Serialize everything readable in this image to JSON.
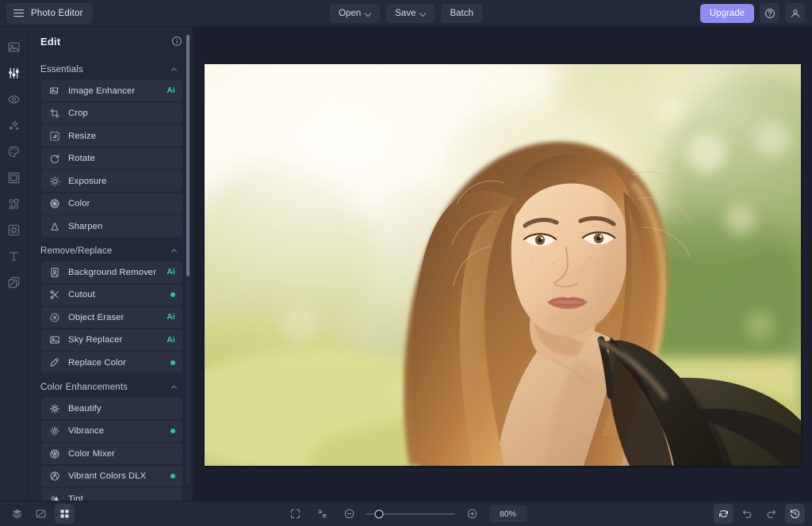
{
  "app": {
    "name": "Photo Editor",
    "menu_icon": "hamburger-icon"
  },
  "topbar": {
    "open_label": "Open",
    "save_label": "Save",
    "batch_label": "Batch",
    "upgrade_label": "Upgrade",
    "help_icon": "question-circle-icon",
    "account_icon": "user-icon",
    "accent_color": "#8f8cf5"
  },
  "rail": {
    "items": [
      {
        "icon": "image-icon",
        "active": false
      },
      {
        "icon": "sliders-icon",
        "active": true
      },
      {
        "icon": "eye-icon",
        "active": false
      },
      {
        "icon": "sparkles-icon",
        "active": false
      },
      {
        "icon": "palette-icon",
        "active": false
      },
      {
        "icon": "frame-icon",
        "active": false
      },
      {
        "icon": "shapes-icon",
        "active": false
      },
      {
        "icon": "effects-icon",
        "active": false
      },
      {
        "icon": "text-icon",
        "active": false
      },
      {
        "icon": "layers-copy-icon",
        "active": false
      }
    ]
  },
  "panel": {
    "title": "Edit",
    "info_icon": "info-circle-icon",
    "ai_badge_color": "#2fd6a8",
    "dot_badge_color": "#21cf9a",
    "sections": [
      {
        "name": "Essentials",
        "expanded": true,
        "items": [
          {
            "label": "Image Enhancer",
            "icon": "image-enhance-icon",
            "badge": "Ai"
          },
          {
            "label": "Crop",
            "icon": "crop-icon",
            "badge": ""
          },
          {
            "label": "Resize",
            "icon": "resize-icon",
            "badge": ""
          },
          {
            "label": "Rotate",
            "icon": "rotate-icon",
            "badge": ""
          },
          {
            "label": "Exposure",
            "icon": "exposure-icon",
            "badge": ""
          },
          {
            "label": "Color",
            "icon": "color-wheel-icon",
            "badge": ""
          },
          {
            "label": "Sharpen",
            "icon": "sharpen-icon",
            "badge": ""
          }
        ]
      },
      {
        "name": "Remove/Replace",
        "expanded": true,
        "items": [
          {
            "label": "Background Remover",
            "icon": "portrait-icon",
            "badge": "Ai"
          },
          {
            "label": "Cutout",
            "icon": "scissors-icon",
            "badge": "dot"
          },
          {
            "label": "Object Eraser",
            "icon": "eraser-icon",
            "badge": "Ai"
          },
          {
            "label": "Sky Replacer",
            "icon": "sky-icon",
            "badge": "Ai"
          },
          {
            "label": "Replace Color",
            "icon": "eyedropper-icon",
            "badge": "dot"
          }
        ]
      },
      {
        "name": "Color Enhancements",
        "expanded": true,
        "items": [
          {
            "label": "Beautify",
            "icon": "beautify-icon",
            "badge": ""
          },
          {
            "label": "Vibrance",
            "icon": "vibrance-icon",
            "badge": "dot"
          },
          {
            "label": "Color Mixer",
            "icon": "color-mixer-icon",
            "badge": ""
          },
          {
            "label": "Vibrant Colors DLX",
            "icon": "vibrant-dlx-icon",
            "badge": "dot"
          },
          {
            "label": "Tint",
            "icon": "tint-icon",
            "badge": ""
          }
        ]
      }
    ]
  },
  "canvas": {
    "image_alt": "Portrait of a woman with long auburn hair seated in sunlit grass with blurred green foliage background"
  },
  "bottombar": {
    "left_tools": [
      {
        "icon": "layers-icon",
        "active": false
      },
      {
        "icon": "compare-icon",
        "active": false
      },
      {
        "icon": "grid-icon",
        "active": true
      }
    ],
    "fit_icon": "fit-screen-icon",
    "actual_icon": "shrink-icon",
    "zoom_out_icon": "zoom-out-icon",
    "zoom_in_icon": "zoom-in-icon",
    "zoom_value": "80%",
    "zoom_percent": 80,
    "right_tools": [
      {
        "icon": "reset-icon",
        "active": true
      },
      {
        "icon": "undo-icon",
        "active": false
      },
      {
        "icon": "redo-icon",
        "active": false
      },
      {
        "icon": "history-icon",
        "active": true
      }
    ]
  }
}
